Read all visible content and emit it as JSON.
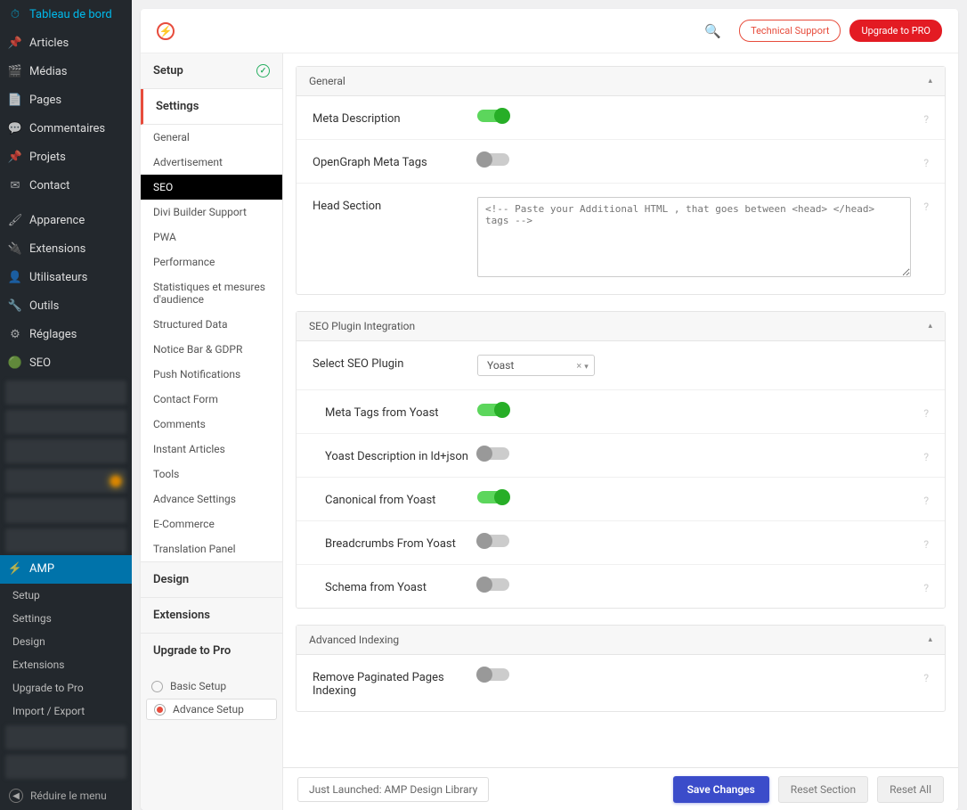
{
  "wp_menu": {
    "dashboard": "Tableau de bord",
    "articles": "Articles",
    "media": "Médias",
    "pages": "Pages",
    "comments": "Commentaires",
    "projects": "Projets",
    "contact": "Contact",
    "appearance": "Apparence",
    "extensions": "Extensions",
    "users": "Utilisateurs",
    "tools": "Outils",
    "settings": "Réglages",
    "seo": "SEO",
    "amp": "AMP"
  },
  "amp_submenu": [
    "Setup",
    "Settings",
    "Design",
    "Extensions",
    "Upgrade to Pro",
    "Import / Export"
  ],
  "collapse": "Réduire le menu",
  "topbar": {
    "technical_support": "Technical Support",
    "upgrade": "Upgrade to PRO"
  },
  "snav": {
    "setup": "Setup",
    "settings": "Settings",
    "subs": [
      "General",
      "Advertisement",
      "SEO",
      "Divi Builder Support",
      "PWA",
      "Performance",
      "Statistiques et mesures d'audience",
      "Structured Data",
      "Notice Bar & GDPR",
      "Push Notifications",
      "Contact Form",
      "Comments",
      "Instant Articles",
      "Tools",
      "Advance Settings",
      "E-Commerce",
      "Translation Panel"
    ],
    "design": "Design",
    "extensions": "Extensions",
    "upgrade": "Upgrade to Pro",
    "basic": "Basic Setup",
    "advance": "Advance Setup"
  },
  "sections": {
    "general": {
      "title": "General",
      "meta_description": "Meta Description",
      "opengraph": "OpenGraph Meta Tags",
      "head_section": "Head Section",
      "head_placeholder": "<!-- Paste your Additional HTML , that goes between <head> </head> tags -->"
    },
    "seo_plugin": {
      "title": "SEO Plugin Integration",
      "select_label": "Select SEO Plugin",
      "select_value": "Yoast",
      "meta_tags": "Meta Tags from Yoast",
      "yoast_desc": "Yoast Description in ld+json",
      "canonical": "Canonical from Yoast",
      "breadcrumbs": "Breadcrumbs From Yoast",
      "schema": "Schema from Yoast"
    },
    "advanced": {
      "title": "Advanced Indexing",
      "remove_paginated": "Remove Paginated Pages Indexing"
    }
  },
  "footer": {
    "launched": "Just Launched: AMP Design Library",
    "save": "Save Changes",
    "reset_section": "Reset Section",
    "reset_all": "Reset All"
  }
}
